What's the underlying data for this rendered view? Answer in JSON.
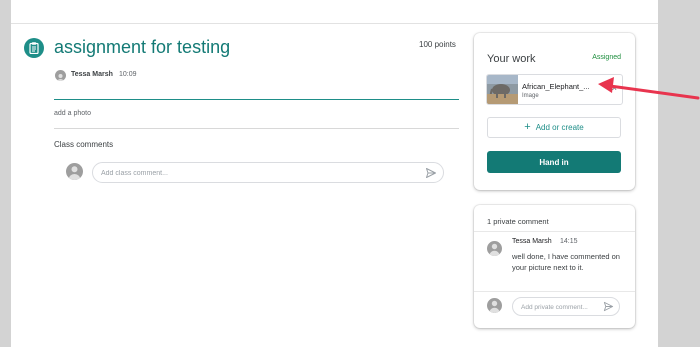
{
  "assignment": {
    "title": "assignment for testing",
    "points": "100 points",
    "author": "Tessa Marsh",
    "time": "10:09",
    "description": "add a photo",
    "icon": "assignment-icon",
    "accent_color": "#1e8e88"
  },
  "class_comments": {
    "label": "Class comments",
    "placeholder": "Add class comment..."
  },
  "your_work": {
    "title": "Your work",
    "status": "Assigned",
    "status_color": "#1e8e3e",
    "attachment": {
      "name": "African_Elephant_...",
      "type": "Image"
    },
    "add_label": "Add or create",
    "hand_in_label": "Hand in"
  },
  "private_comments": {
    "header": "1 private comment",
    "comment": {
      "author": "Tessa Marsh",
      "time": "14:15",
      "text": "well done, I have commented on your picture next to it."
    },
    "placeholder": "Add private comment..."
  },
  "annotation": {
    "arrow_color": "#e8344e"
  }
}
